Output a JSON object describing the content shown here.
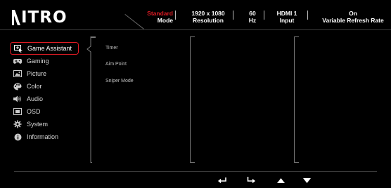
{
  "brand": "ITRO",
  "status": [
    {
      "value": "Standard",
      "label": "Mode",
      "value_color": "#e01b24"
    },
    {
      "value": "1920 x 1080",
      "label": "Resolution"
    },
    {
      "value": "60",
      "label": "Hz"
    },
    {
      "value": "HDMI 1",
      "label": "Input"
    },
    {
      "value": "On",
      "label": "Variable Refresh Rate"
    }
  ],
  "menu": [
    {
      "label": "Game Assistant",
      "icon": "game-assistant-icon",
      "active": true
    },
    {
      "label": "Gaming",
      "icon": "gamepad-icon"
    },
    {
      "label": "Picture",
      "icon": "picture-icon"
    },
    {
      "label": "Color",
      "icon": "palette-icon"
    },
    {
      "label": "Audio",
      "icon": "speaker-icon"
    },
    {
      "label": "OSD",
      "icon": "osd-icon"
    },
    {
      "label": "System",
      "icon": "gear-icon"
    },
    {
      "label": "Information",
      "icon": "info-icon"
    }
  ],
  "submenu": [
    "Timer",
    "Aim Point",
    "Sniper Mode"
  ],
  "nav": [
    "back-icon",
    "enter-icon",
    "up-arrow-icon",
    "down-arrow-icon"
  ],
  "colors": {
    "accent": "#e01b24",
    "background": "#000000"
  }
}
